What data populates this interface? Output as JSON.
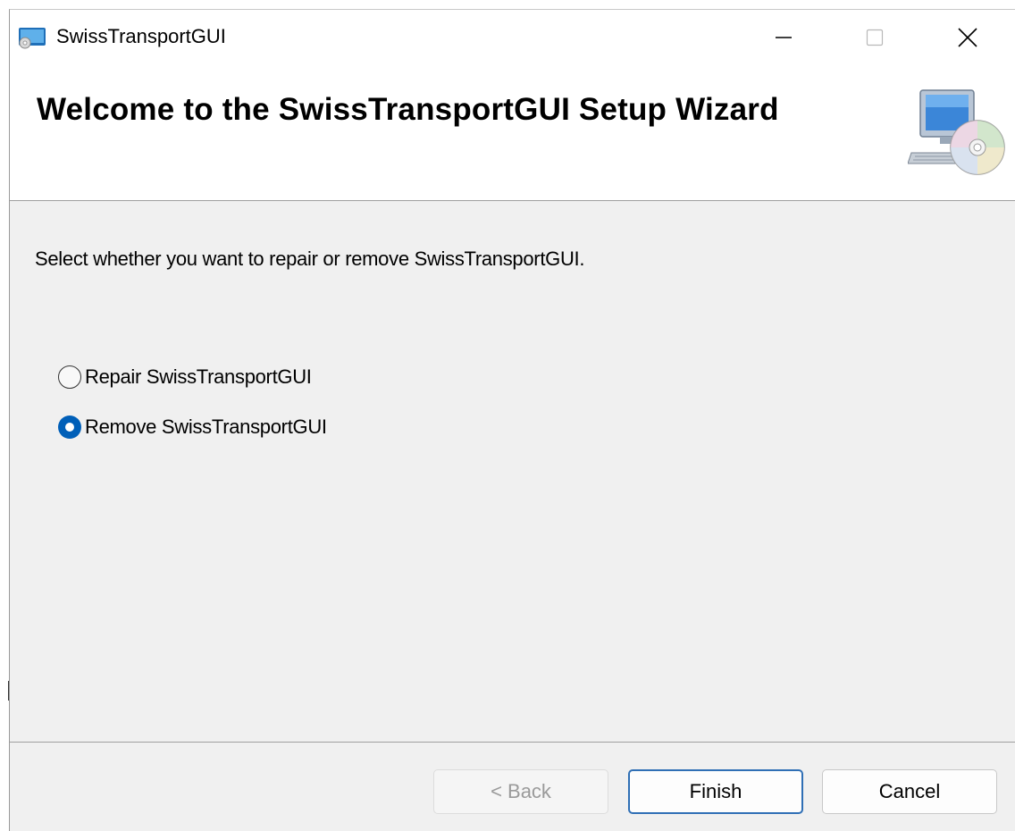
{
  "window": {
    "title": "SwissTransportGUI",
    "app_icon": "installer-app-icon",
    "controls": {
      "minimize_icon": "minimize-icon",
      "maximize_icon": "maximize-icon",
      "close_icon": "close-icon"
    }
  },
  "banner": {
    "title": "Welcome to the SwissTransportGUI Setup Wizard",
    "icon": "computer-cd-icon"
  },
  "body": {
    "instruction": "Select whether you want to repair or remove SwissTransportGUI.",
    "options": [
      {
        "label": "Repair SwissTransportGUI",
        "selected": false
      },
      {
        "label": "Remove SwissTransportGUI",
        "selected": true
      }
    ]
  },
  "footer": {
    "back_label": "< Back",
    "back_enabled": false,
    "finish_label": "Finish",
    "cancel_label": "Cancel"
  },
  "colors": {
    "accent": "#005fb8",
    "body_background": "#f0f0f0",
    "banner_background": "#ffffff",
    "disabled_text": "#9a9a9a"
  }
}
